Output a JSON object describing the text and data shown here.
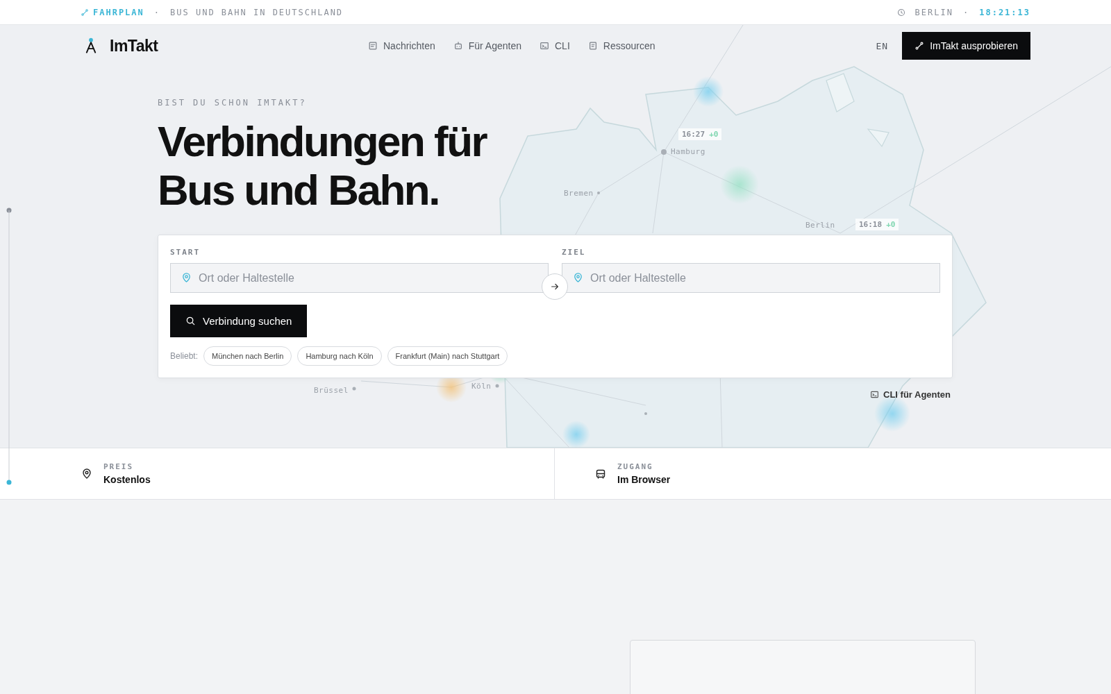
{
  "top_bar": {
    "brand": "FAHRPLAN",
    "separator": "·",
    "tagline": "BUS UND BAHN IN DEUTSCHLAND",
    "city": "BERLIN",
    "time_separator": "·",
    "time": "18:21:13"
  },
  "header": {
    "logo": "ImTakt",
    "nav": [
      {
        "label": "Nachrichten",
        "kind": "news"
      },
      {
        "label": "Für Agenten",
        "kind": "robot"
      },
      {
        "label": "CLI",
        "kind": "terminal"
      },
      {
        "label": "Ressourcen",
        "kind": "book"
      }
    ],
    "language": "EN",
    "cta": "ImTakt ausprobieren"
  },
  "map": {
    "cities": [
      {
        "name": "Hamburg"
      },
      {
        "name": "Bremen"
      },
      {
        "name": "Berlin"
      },
      {
        "name": "Brüssel"
      },
      {
        "name": "Köln"
      }
    ],
    "badges": [
      {
        "time": "16:27",
        "delay": "+0"
      },
      {
        "time": "16:18",
        "delay": "+0"
      }
    ]
  },
  "hero": {
    "eyebrow": "BIST DU SCHON IMTAKT?",
    "headline": [
      "Verbindungen für",
      "Bus und Bahn."
    ]
  },
  "search": {
    "fields": [
      {
        "label": "START",
        "placeholder": "Ort oder Haltestelle"
      },
      {
        "label": "ZIEL",
        "placeholder": "Ort oder Haltestelle"
      }
    ],
    "button": "Verbindung suchen",
    "popular_label": "Beliebt:",
    "popular": [
      "München nach Berlin",
      "Hamburg nach Köln",
      "Frankfurt (Main) nach Stuttgart"
    ]
  },
  "cli_link": "CLI für Agenten",
  "stats": [
    {
      "kind": "pin",
      "label": "PREIS",
      "value": "Kostenlos"
    },
    {
      "kind": "bus",
      "label": "ZUGANG",
      "value": "Im Browser"
    }
  ]
}
